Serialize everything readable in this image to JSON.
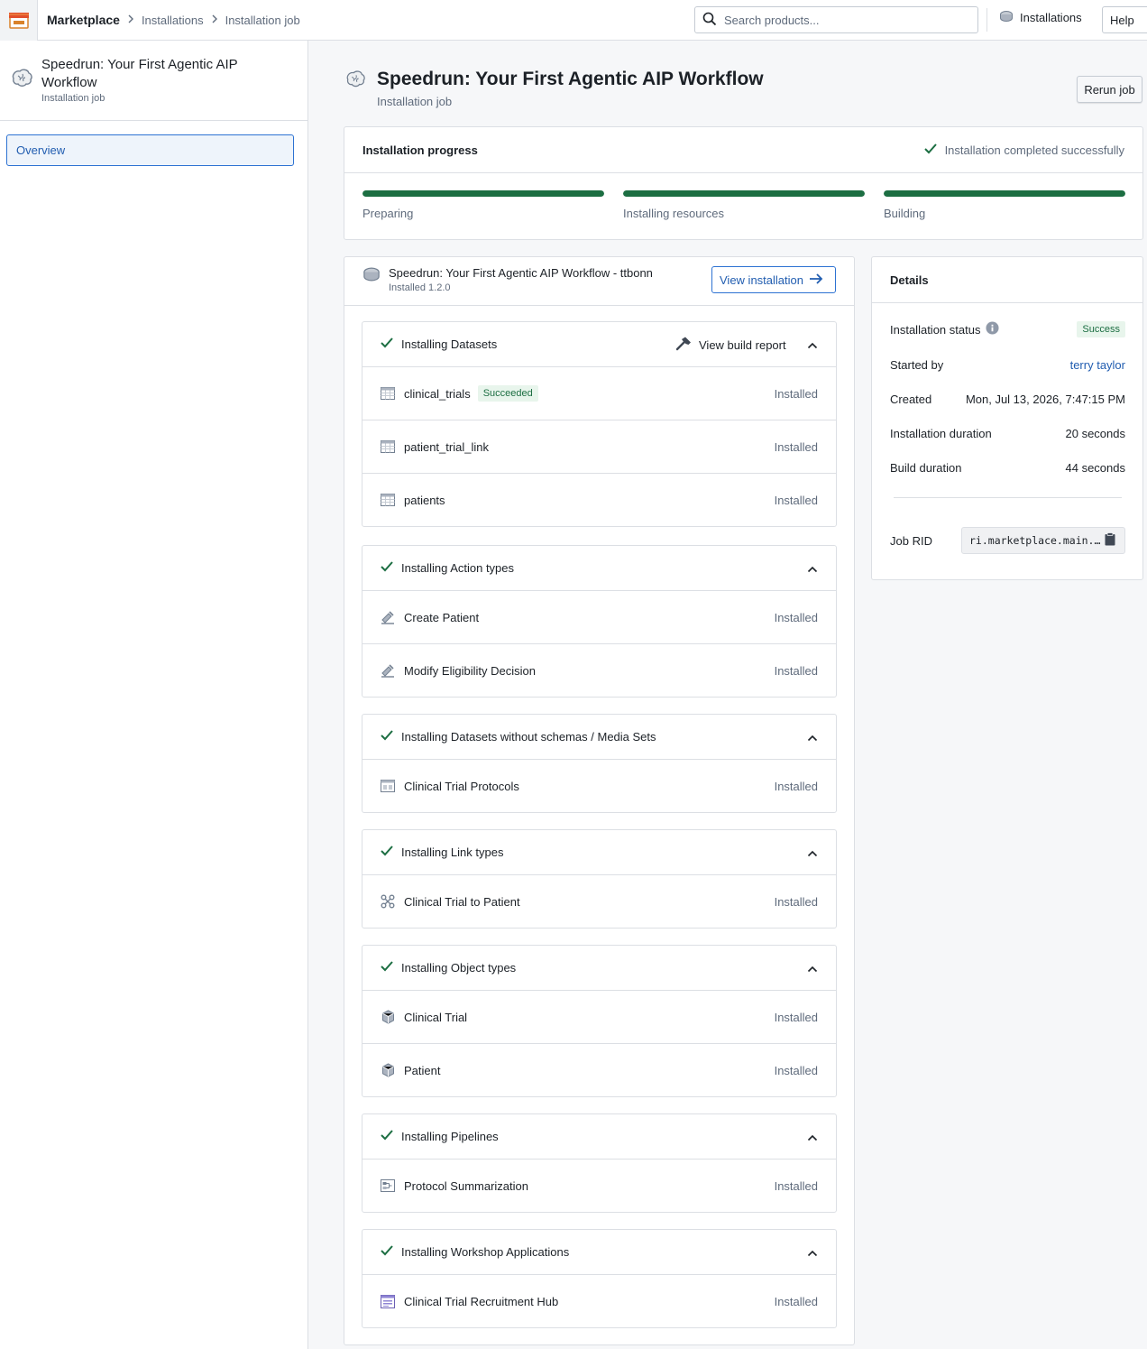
{
  "topbar": {
    "breadcrumbs": [
      "Marketplace",
      "Installations",
      "Installation job"
    ],
    "search_placeholder": "Search products...",
    "installations_label": "Installations",
    "help_label": "Help"
  },
  "sidebar": {
    "title": "Speedrun: Your First Agentic AIP Workflow",
    "subtitle": "Installation job",
    "nav_items": [
      {
        "label": "Overview",
        "active": true
      }
    ]
  },
  "header": {
    "title": "Speedrun: Your First Agentic AIP Workflow",
    "subtitle": "Installation job",
    "rerun_label": "Rerun job"
  },
  "progress": {
    "title": "Installation progress",
    "status": "Installation completed successfully",
    "steps": [
      {
        "label": "Preparing",
        "progress": 1.0
      },
      {
        "label": "Installing resources",
        "progress": 1.0
      },
      {
        "label": "Building",
        "progress": 1.0
      }
    ]
  },
  "installation": {
    "title": "Speedrun: Your First Agentic AIP Workflow - ttbonn",
    "version": "Installed 1.2.0",
    "view_label": "View installation",
    "build_report_label": "View build report",
    "sections": [
      {
        "title": "Installing Datasets",
        "items": [
          {
            "name": "clinical_trials",
            "badge": "Succeeded",
            "status": "Installed",
            "icon": "dataset-icon"
          },
          {
            "name": "patient_trial_link",
            "status": "Installed",
            "icon": "dataset-icon"
          },
          {
            "name": "patients",
            "status": "Installed",
            "icon": "dataset-icon"
          }
        ]
      },
      {
        "title": "Installing Action types",
        "items": [
          {
            "name": "Create Patient",
            "status": "Installed",
            "icon": "action-icon"
          },
          {
            "name": "Modify Eligibility Decision",
            "status": "Installed",
            "icon": "action-icon"
          }
        ]
      },
      {
        "title": "Installing Datasets without schemas / Media Sets",
        "items": [
          {
            "name": "Clinical Trial Protocols",
            "status": "Installed",
            "icon": "media-set-icon"
          }
        ]
      },
      {
        "title": "Installing Link types",
        "items": [
          {
            "name": "Clinical Trial to Patient",
            "status": "Installed",
            "icon": "link-type-icon"
          }
        ]
      },
      {
        "title": "Installing Object types",
        "items": [
          {
            "name": "Clinical Trial",
            "status": "Installed",
            "icon": "object-type-icon"
          },
          {
            "name": "Patient",
            "status": "Installed",
            "icon": "object-type-icon"
          }
        ]
      },
      {
        "title": "Installing Pipelines",
        "items": [
          {
            "name": "Protocol Summarization",
            "status": "Installed",
            "icon": "pipeline-icon"
          }
        ]
      },
      {
        "title": "Installing Workshop Applications",
        "items": [
          {
            "name": "Clinical Trial Recruitment Hub",
            "status": "Installed",
            "icon": "workshop-icon"
          }
        ]
      }
    ]
  },
  "details": {
    "title": "Details",
    "status_label": "Installation status",
    "status_value": "Success",
    "started_by_label": "Started by",
    "started_by_value": "terry taylor",
    "created_label": "Created",
    "created_value": "Mon, Jul 13, 2026, 7:47:15 PM",
    "install_duration_label": "Installation duration",
    "install_duration_value": "20 seconds",
    "build_duration_label": "Build duration",
    "build_duration_value": "44 seconds",
    "job_rid_label": "Job RID",
    "job_rid_value": "ri.marketplace.main.installation-job"
  },
  "colors": {
    "success": "#1c6e42",
    "link": "#215db0",
    "border": "#dcdfe4",
    "muted": "#5f6b7c"
  }
}
